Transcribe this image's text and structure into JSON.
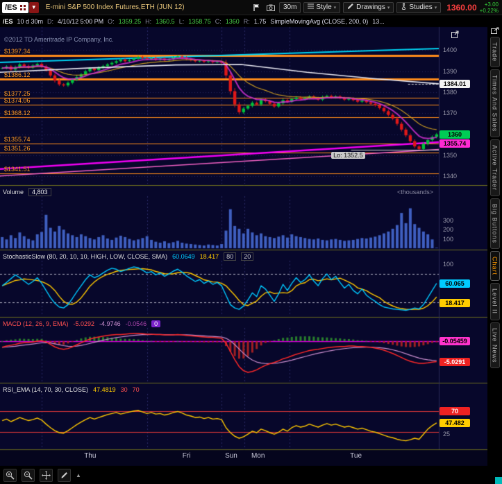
{
  "toolbar": {
    "symbol": "/ES",
    "title": "E-mini S&P 500 Index Futures,ETH (JUN 12)",
    "timeframe": "30m",
    "style_label": "Style",
    "drawings_label": "Drawings",
    "studies_label": "Studies",
    "last_price": "1360.00",
    "change": "+3.00",
    "change_pct": "+0.22%"
  },
  "data_strip": {
    "symbol": "/ES",
    "range": "10 d 30m",
    "date_label": "D:",
    "date": "4/10/12 5:00 PM",
    "o_label": "O:",
    "o": "1359.25",
    "h_label": "H:",
    "h": "1360.5",
    "l_label": "L:",
    "l": "1358.75",
    "c_label": "C:",
    "c": "1360",
    "r_label": "R:",
    "r": "1.75",
    "study": "SimpleMovingAvg (CLOSE, 200, 0)",
    "study_value": "13..."
  },
  "price_panel": {
    "copyright": "©2012 TD Ameritrade IP Company, Inc.",
    "low_label": "Lo: 1352.5",
    "levels": [
      {
        "label": "$1397.34",
        "value": 1397.34,
        "width": 3
      },
      {
        "label": "$1386.12",
        "value": 1386.12,
        "width": 3
      },
      {
        "label": "$1377.25",
        "value": 1377.25,
        "width": 1
      },
      {
        "label": "$1374.06",
        "value": 1374.06,
        "width": 1
      },
      {
        "label": "$1368.12",
        "value": 1368.12,
        "width": 1
      },
      {
        "label": "$1355.74",
        "value": 1355.74,
        "width": 1
      },
      {
        "label": "$1351.26",
        "value": 1351.26,
        "width": 1
      },
      {
        "label": "$1341.51",
        "value": 1341.51,
        "width": 1
      }
    ]
  },
  "volume_panel": {
    "label": "Volume",
    "value": "4,803",
    "unit": "<thousands>"
  },
  "stoch_panel": {
    "title": "StochasticSlow (80, 20, 10, 10, HIGH, LOW, CLOSE, SMA)",
    "v1": "60.0649",
    "v2": "18.417",
    "p1": "80",
    "p2": "20"
  },
  "macd_panel": {
    "title": "MACD (12, 26, 9, EMA)",
    "v1": "-5.0292",
    "v2": "-4.9746",
    "v3": "-0.0546",
    "zero": "0"
  },
  "rsi_panel": {
    "title": "RSI_EMA (14, 70, 30, CLOSE)",
    "v1": "47.4819",
    "p1": "30",
    "p2": "70"
  },
  "axis": {
    "price": {
      "ticks": [
        1400,
        1390,
        1380,
        1370,
        1360,
        1350,
        1340
      ],
      "badges": [
        {
          "text": "1384.01",
          "value": 1384.01,
          "bg": "#f2f2f2",
          "fg": "#000000"
        },
        {
          "text": "1360",
          "value": 1360,
          "bg": "#00cc55",
          "fg": "#000000"
        },
        {
          "text": "1355.74",
          "value": 1355.74,
          "bg": "#ff2ad4",
          "fg": "#000000"
        }
      ]
    },
    "volume": {
      "ticks": [
        300,
        200,
        100
      ],
      "badges": []
    },
    "stoch": {
      "ticks": [
        100
      ],
      "badges": [
        {
          "text": "60.065",
          "value": 60.065,
          "bg": "#00ccff",
          "fg": "#000000"
        },
        {
          "text": "18.417",
          "value": 18.417,
          "bg": "#ffcc00",
          "fg": "#000000"
        }
      ]
    },
    "macd": {
      "ticks": [],
      "badges": [
        {
          "text": "-0.05459",
          "value": -0.055,
          "bg": "#ff33cc",
          "fg": "#000000"
        },
        {
          "text": "-5.0291",
          "value": -5.0291,
          "bg": "#ee2222",
          "fg": "#ffffff"
        }
      ]
    },
    "rsi": {
      "ticks": [
        25
      ],
      "badges": [
        {
          "text": "70",
          "value": 70,
          "bg": "#ee2222",
          "fg": "#ffffff"
        },
        {
          "text": "47.482",
          "value": 47.482,
          "bg": "#ffcc00",
          "fg": "#000000"
        }
      ]
    }
  },
  "time_axis": {
    "labels": [
      {
        "text": "Thu",
        "x": 0.206
      },
      {
        "text": "Fri",
        "x": 0.43
      },
      {
        "text": "Sun",
        "x": 0.527
      },
      {
        "text": "Mon",
        "x": 0.587
      },
      {
        "text": "Tue",
        "x": 0.812
      }
    ],
    "session_boundaries": [
      0.095,
      0.335,
      0.505,
      0.557,
      0.66
    ]
  },
  "side_tabs": [
    {
      "label": "Trade",
      "active": false
    },
    {
      "label": "Times And Sales",
      "active": false
    },
    {
      "label": "Active Trader",
      "active": false
    },
    {
      "label": "Big Buttons",
      "active": false
    },
    {
      "label": "Chart",
      "active": true
    },
    {
      "label": "Level II",
      "active": false
    },
    {
      "label": "Live News",
      "active": false
    }
  ],
  "bottom_tools": [
    "zoom-in-icon",
    "zoom-area-icon",
    "pan-icon",
    "draw-icon",
    "collapse-icon"
  ],
  "icons": {
    "toolbar": [
      "flag-icon",
      "camera-icon",
      "style-icon",
      "drawings-icon",
      "studies-icon",
      "symbol-grid-icon",
      "symbol-dropdown-caret"
    ],
    "misc": [
      "expand-panel-icon",
      "popout-icon",
      "resize-grip"
    ]
  },
  "chart_data": [
    {
      "type": "candlestick",
      "panel": "price",
      "symbol": "/ES",
      "timeframe": "30m",
      "bars": 100,
      "ylim": [
        1336.5,
        1411
      ],
      "closes": [
        1391.5,
        1392.25,
        1390.75,
        1392,
        1393.25,
        1392.5,
        1391.75,
        1392.75,
        1393.5,
        1392.25,
        1390.5,
        1388,
        1385.5,
        1383.75,
        1383.25,
        1384.5,
        1386,
        1387.25,
        1388.5,
        1390,
        1391.25,
        1390.5,
        1391.75,
        1392.5,
        1393.25,
        1394,
        1394.75,
        1395.5,
        1394.75,
        1395.25,
        1396,
        1396.75,
        1396.25,
        1395.75,
        1396.25,
        1395.5,
        1396,
        1395.25,
        1395.75,
        1396.5,
        1397,
        1396.5,
        1395.75,
        1395.25,
        1394.75,
        1395,
        1394.5,
        1394.75,
        1394.25,
        1394.5,
        1394,
        1388,
        1380.5,
        1374.25,
        1370.5,
        1372.25,
        1373.5,
        1375,
        1374.25,
        1376.5,
        1375.75,
        1374.5,
        1373.25,
        1374.75,
        1376.25,
        1375.5,
        1376.75,
        1377.5,
        1376.75,
        1377.25,
        1378,
        1377.25,
        1376.5,
        1377.75,
        1378.25,
        1377.5,
        1378,
        1377.25,
        1376.5,
        1377,
        1376.25,
        1375.5,
        1376,
        1375.25,
        1374.5,
        1373.75,
        1372.5,
        1371,
        1369.25,
        1367.5,
        1365,
        1362.25,
        1359.5,
        1356.75,
        1354.25,
        1353,
        1355.5,
        1357.25,
        1358.75,
        1360
      ],
      "sma200_anchors": [
        [
          0,
          1389.5
        ],
        [
          0.2,
          1391.5
        ],
        [
          0.4,
          1393
        ],
        [
          0.55,
          1393.2
        ],
        [
          0.7,
          1389.5
        ],
        [
          0.85,
          1386.5
        ],
        [
          1,
          1384.01
        ]
      ],
      "trendlines": [
        {
          "color": "#00e0ff",
          "width": 2,
          "from": [
            0,
            1394.2
          ],
          "to": [
            1,
            1400.8
          ]
        },
        {
          "color": "#ff00ff",
          "width": 2.5,
          "from": [
            0,
            1343.5
          ],
          "to": [
            1,
            1356.3
          ]
        },
        {
          "color": "#ff66cc",
          "width": 1.5,
          "from": [
            0,
            1340.2
          ],
          "to": [
            1,
            1352.8
          ]
        }
      ],
      "levels": [
        1397.34,
        1386.12,
        1377.25,
        1374.06,
        1368.12,
        1355.74,
        1351.26,
        1341.51
      ],
      "low_marker": 1352.5,
      "prior_ref": 1384.01
    },
    {
      "type": "bar",
      "panel": "volume",
      "ylim": [
        0,
        560
      ],
      "unit": "thousands",
      "values": [
        120,
        95,
        140,
        110,
        170,
        130,
        100,
        85,
        150,
        175,
        360,
        220,
        180,
        240,
        200,
        160,
        140,
        120,
        150,
        130,
        110,
        95,
        120,
        140,
        105,
        90,
        115,
        135,
        120,
        100,
        85,
        95,
        110,
        130,
        90,
        70,
        60,
        75,
        55,
        65,
        80,
        60,
        50,
        45,
        40,
        35,
        30,
        40,
        35,
        30,
        45,
        190,
        420,
        240,
        210,
        160,
        210,
        170,
        140,
        160,
        130,
        120,
        110,
        125,
        140,
        115,
        150,
        130,
        120,
        110,
        100,
        95,
        105,
        90,
        85,
        95,
        100,
        90,
        80,
        85,
        90,
        100,
        110,
        105,
        115,
        125,
        140,
        160,
        180,
        210,
        250,
        380,
        270,
        430,
        260,
        220,
        180,
        150,
        95,
        4.8
      ]
    },
    {
      "type": "line",
      "panel": "stochastic",
      "ylim": [
        -8,
        108
      ],
      "hlines": [
        80,
        20
      ],
      "k": [
        55,
        62,
        70,
        78,
        72,
        65,
        58,
        64,
        72,
        60,
        45,
        30,
        18,
        10,
        8,
        15,
        28,
        42,
        55,
        68,
        78,
        72,
        76,
        82,
        88,
        92,
        90,
        85,
        88,
        92,
        95,
        93,
        88,
        82,
        85,
        78,
        82,
        75,
        80,
        86,
        90,
        84,
        76,
        70,
        64,
        68,
        60,
        65,
        58,
        62,
        55,
        35,
        15,
        8,
        5,
        12,
        25,
        40,
        32,
        55,
        48,
        35,
        22,
        38,
        58,
        45,
        60,
        72,
        62,
        68,
        78,
        65,
        55,
        70,
        80,
        68,
        75,
        62,
        50,
        58,
        45,
        38,
        48,
        35,
        28,
        22,
        15,
        10,
        8,
        6,
        5,
        4,
        3,
        5,
        8,
        6,
        15,
        30,
        45,
        60
      ],
      "d_derived": "sma5(k)",
      "last": [
        60.0649,
        18.417
      ]
    },
    {
      "type": "line",
      "panel": "macd",
      "ylim": [
        -9.8,
        3.2
      ],
      "zero_line": 0,
      "macd": [
        -1.5,
        -1.2,
        -1,
        -0.8,
        -0.5,
        -0.4,
        -0.3,
        -0.2,
        0,
        0.1,
        -0.2,
        -0.8,
        -1.4,
        -1.8,
        -2,
        -1.8,
        -1.4,
        -0.9,
        -0.4,
        0.1,
        0.5,
        0.8,
        1,
        1.2,
        1.4,
        1.5,
        1.6,
        1.6,
        1.7,
        1.8,
        1.9,
        1.9,
        1.8,
        1.7,
        1.7,
        1.6,
        1.6,
        1.5,
        1.5,
        1.5,
        1.6,
        1.5,
        1.4,
        1.3,
        1.2,
        1.1,
        1,
        0.9,
        0.9,
        0.8,
        0.7,
        -0.5,
        -2.5,
        -4.5,
        -6.2,
        -7.2,
        -7.6,
        -7.4,
        -7,
        -6.4,
        -5.9,
        -5.5,
        -5.2,
        -4.8,
        -4.3,
        -4,
        -3.6,
        -3.2,
        -2.9,
        -2.6,
        -2.3,
        -2.1,
        -2,
        -1.8,
        -1.6,
        -1.5,
        -1.4,
        -1.3,
        -1.3,
        -1.2,
        -1.2,
        -1.3,
        -1.3,
        -1.4,
        -1.5,
        -1.7,
        -1.9,
        -2.2,
        -2.6,
        -3,
        -3.5,
        -4,
        -4.5,
        -4.9,
        -5.2,
        -5.4,
        -5.4,
        -5.3,
        -5.1,
        -5
      ],
      "signal_derived": "ema9(macd)",
      "last": [
        -5.0292,
        -4.9746,
        -0.0546
      ]
    },
    {
      "type": "line",
      "panel": "rsi",
      "ylim": [
        -5,
        105
      ],
      "hlines": [
        70,
        30
      ],
      "values": [
        52,
        55,
        50,
        54,
        58,
        55,
        52,
        54,
        57,
        53,
        45,
        38,
        32,
        28,
        27,
        32,
        38,
        44,
        49,
        54,
        58,
        55,
        58,
        61,
        64,
        66,
        68,
        65,
        67,
        69,
        71,
        72,
        69,
        66,
        68,
        65,
        66,
        63,
        65,
        68,
        70,
        67,
        63,
        61,
        58,
        59,
        56,
        58,
        55,
        56,
        54,
        38,
        28,
        21,
        17,
        20,
        25,
        31,
        28,
        35,
        32,
        28,
        25,
        29,
        35,
        31,
        38,
        42,
        39,
        41,
        45,
        42,
        39,
        43,
        46,
        43,
        45,
        42,
        39,
        41,
        38,
        35,
        37,
        34,
        31,
        29,
        26,
        23,
        20,
        18,
        15,
        13,
        12,
        14,
        17,
        15,
        25,
        35,
        42,
        47.5
      ],
      "last": 47.4819
    }
  ]
}
